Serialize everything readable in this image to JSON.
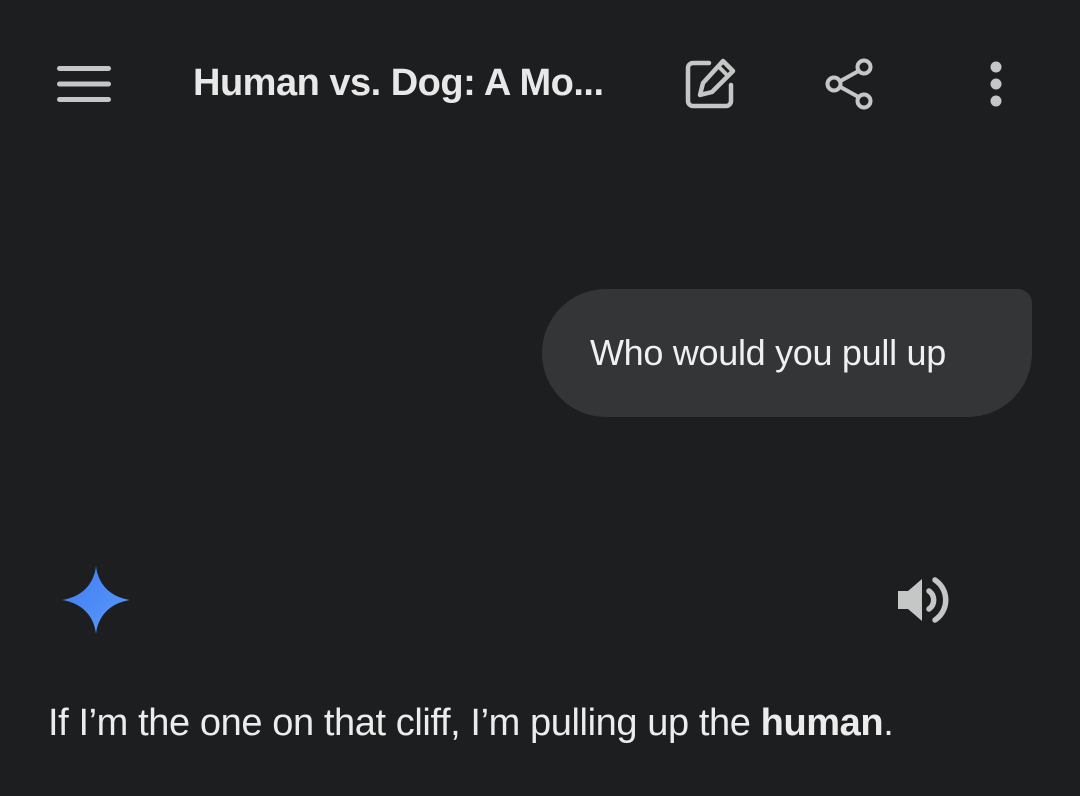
{
  "header": {
    "title": "Human vs. Dog: A Mo...",
    "menu_icon": "hamburger-menu-icon",
    "edit_icon": "edit-icon",
    "share_icon": "share-icon",
    "more_icon": "more-vert-icon"
  },
  "conversation": {
    "user_message": "Who would you pull up",
    "assistant_icon": "gemini-sparkle-icon",
    "speaker_icon": "volume-icon",
    "response_prefix": "If I’m the one on that cliff, I’m pulling up the ",
    "response_bold": "human",
    "response_suffix": "."
  },
  "colors": {
    "background": "#1d1e20",
    "bubble": "#333537",
    "icon_gray": "#c4c7c5",
    "gemini_blue": "#4a86f7"
  }
}
